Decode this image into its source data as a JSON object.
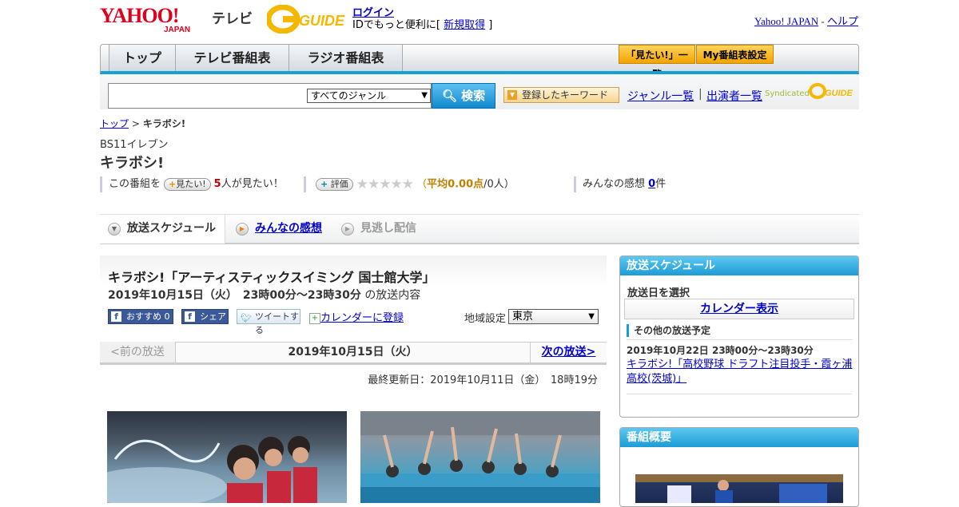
{
  "header": {
    "logo_text": "YAHOO! JAPAN",
    "tv_label": "テレビ",
    "gguide_logo": "G-GUIDE",
    "login_link": "ログイン",
    "id_prefix": "IDでもっと便利に[",
    "signup_link": "新規取得",
    "id_suffix": "]",
    "yahoo_japan_link": "Yahoo! JAPAN",
    "dash": "-",
    "help_link": "ヘルプ"
  },
  "nav": {
    "tabs": [
      "トップ",
      "テレビ番組表",
      "ラジオ番組表"
    ],
    "mitai_list": "「見たい!」一覧",
    "my_bangumi": "My番組表設定"
  },
  "search": {
    "input_value": "",
    "genre_select": "すべてのジャンル",
    "search_button": "検索",
    "keyword_button": "登録したキーワード",
    "genre_list_link": "ジャンル一覧",
    "separator": "|",
    "cast_list_link": "出演者一覧",
    "syndicated": "Syndicated"
  },
  "breadcrumb": {
    "top": "トップ",
    "sep": ">",
    "current": "キラボシ!"
  },
  "program": {
    "channel": "BS11イレブン",
    "title": "キラボシ!",
    "mitai_prefix": "この番組を",
    "mitai_pill": "見たい!",
    "mitai_count": "5",
    "mitai_suffix": "人が見たい！",
    "rating_pill": "評価",
    "stars": "★★★★★",
    "rating_open": "（",
    "rating_avg": "平均0.00点",
    "rating_people": "/0人）",
    "kanso_prefix": "みんなの感想",
    "kanso_count": "0",
    "kanso_suffix": "件"
  },
  "tabs": {
    "schedule": "放送スケジュール",
    "kanso": "みんなの感想",
    "minogashi": "見逃し配信"
  },
  "episode": {
    "title": "キラボシ!「アーティスティックスイミング 国士館大学」",
    "datetime": "2019年10月15日（火）　23時00分～23時30分",
    "datetime_suffix": "の放送内容",
    "fb_osusume": "おすすめ 0",
    "fb_share": "シェア",
    "tweet": "ツイートする",
    "calendar_register": "カレンダーに登録",
    "region_label": "地域設定",
    "region_value": "東京",
    "prev": "<前の放送",
    "current_date": "2019年10月15日（火）",
    "next": "次の放送>",
    "updated": "最終更新日：2019年10月11日（金）　18時19分"
  },
  "sidebar": {
    "schedule_head": "放送スケジュール",
    "select_date": "放送日を選択",
    "calendar_button": "カレンダー表示",
    "other_head": "その他の放送予定",
    "other_date": "2019年10月22日  23時00分～23時30分",
    "other_link": "キラボシ!「高校野球 ドラフト注目投手・霞ヶ浦高校(茨城)」",
    "summary_head": "番組概要"
  },
  "colors": {
    "accent_blue": "#16a0d8",
    "link": "#0000cc",
    "orange": "#f2a300",
    "facebook": "#3b5998"
  }
}
